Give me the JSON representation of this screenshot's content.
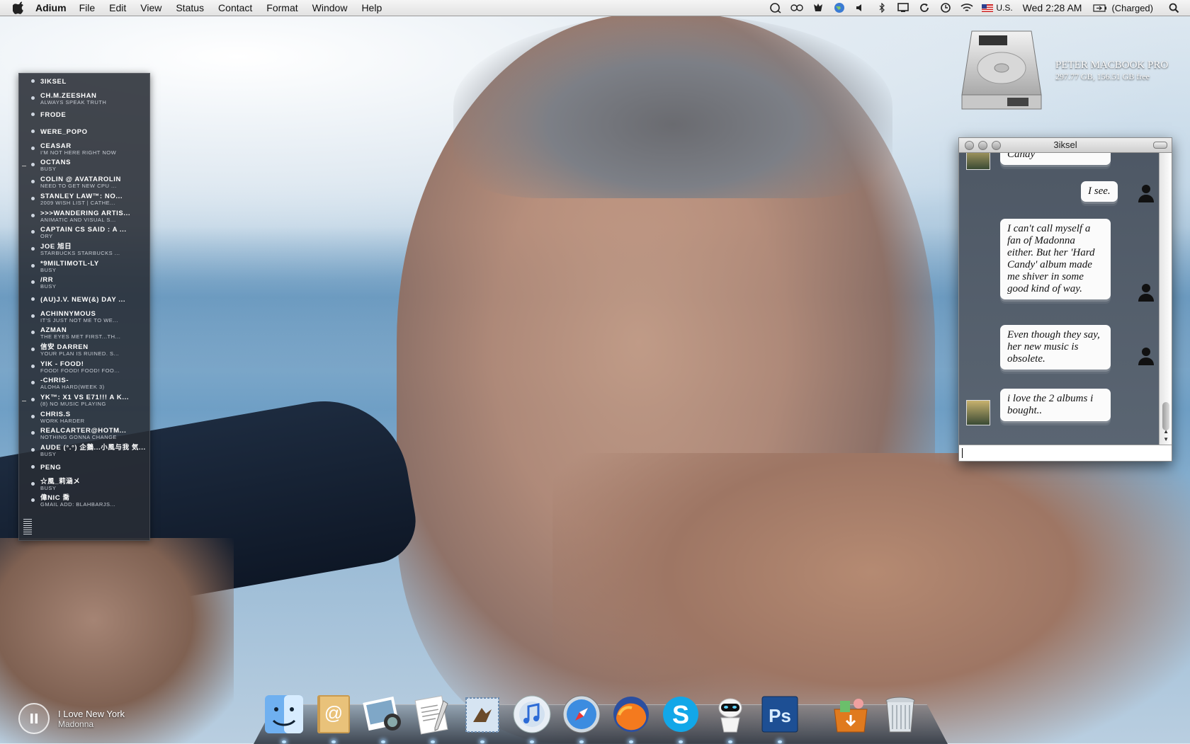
{
  "menubar": {
    "app_name": "Adium",
    "menus": [
      "File",
      "Edit",
      "View",
      "Status",
      "Contact",
      "Format",
      "Window",
      "Help"
    ],
    "input_locale": "U.S.",
    "clock": "Wed 2:28 AM",
    "battery": "(Charged)"
  },
  "contacts": [
    {
      "name": "3iksel",
      "status": ""
    },
    {
      "name": "ch.m.zeeshan",
      "status": "always speak truth"
    },
    {
      "name": "Frode",
      "status": ""
    },
    {
      "name": "were_popo",
      "status": ""
    },
    {
      "name": "ceasar",
      "status": "I'm not here right now"
    },
    {
      "name": "octans",
      "status": "busy"
    },
    {
      "name": "Colin @ avatarolin",
      "status": "need to get new cpu ..."
    },
    {
      "name": "Stanley Law™: No...",
      "status": "2009 Wish List | Cathe..."
    },
    {
      "name": ">>>wandering artis...",
      "status": "animatic and visual s..."
    },
    {
      "name": "captain cs said : a ...",
      "status": "ory"
    },
    {
      "name": "Joe 旭日",
      "status": "starbucks starbucks ..."
    },
    {
      "name": "*9miltimotl-ly",
      "status": "busy"
    },
    {
      "name": "/rr",
      "status": "busy"
    },
    {
      "name": "(AU)J.V. New(&) Day ...",
      "status": ""
    },
    {
      "name": "achinnymous",
      "status": "It's just not me to we..."
    },
    {
      "name": "azman",
      "status": "The eyes met first...th..."
    },
    {
      "name": "信安 Darren",
      "status": "your plan is ruined. s..."
    },
    {
      "name": "Yik - Food!",
      "status": "Food! Food! Food! Foo..."
    },
    {
      "name": "-Chris-",
      "status": "Aloha Hard(Week 3)"
    },
    {
      "name": "YK™: X1 vs E71!!! A K...",
      "status": "(8) No music playing"
    },
    {
      "name": "chris.s",
      "status": "work harder"
    },
    {
      "name": "realcarter@hotm...",
      "status": "nothing gonna change"
    },
    {
      "name": "Aude (°.°) 企鵝...小風与我 気...",
      "status": "busy"
    },
    {
      "name": "peng",
      "status": ""
    },
    {
      "name": "☆風_莉涵メ",
      "status": "busy"
    },
    {
      "name": "偉nic 喬",
      "status": "Gmail add: blahbarjs..."
    }
  ],
  "drive": {
    "name": "PETER MACBOOK PRO",
    "stats": "297.77 GB, 156.51 GB free",
    "icon": "hard-drive-icon"
  },
  "chat": {
    "title": "3iksel",
    "messages": [
      {
        "from": "buddy",
        "text": "Candy"
      },
      {
        "from": "me",
        "text": "I see."
      },
      {
        "from": "me",
        "text": "I can't call myself a fan of Madonna either. But her 'Hard Candy' album made me shiver in some good kind of way."
      },
      {
        "from": "me",
        "text": "Even though they say, her new music is obsolete."
      },
      {
        "from": "buddy",
        "text": "i love the 2 albums i bought.."
      }
    ],
    "input_value": ""
  },
  "now_playing": {
    "title": "I Love New York",
    "artist": "Madonna"
  },
  "dock": {
    "apps": [
      "finder-icon",
      "address-book-icon",
      "iphoto-icon",
      "textedit-icon",
      "mail-icon",
      "itunes-icon",
      "safari-icon",
      "firefox-icon",
      "skype-icon",
      "robot-icon",
      "photoshop-icon"
    ],
    "stack": "downloads-stack-icon",
    "trash": "trash-icon"
  },
  "colors": {
    "menubar": "#e8e8e8",
    "contact_list_bg": "#2c3038",
    "chat_bg": "#505a66",
    "bubble": "#fbfbfb"
  }
}
